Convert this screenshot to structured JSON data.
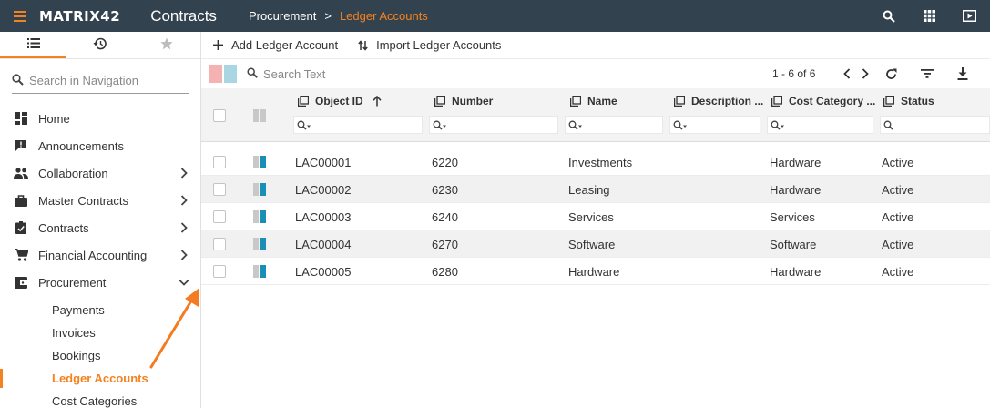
{
  "app": {
    "logo": "MATRIX42",
    "title": "Contracts",
    "breadcrumb": {
      "parent": "Procurement",
      "separator": ">",
      "current": "Ledger Accounts"
    },
    "top_icons": [
      "search-icon",
      "apps-grid-icon",
      "play-icon"
    ]
  },
  "sidebar": {
    "tabs": [
      {
        "icon": "list-icon",
        "active": true
      },
      {
        "icon": "history-icon",
        "active": false
      },
      {
        "icon": "star-icon",
        "active": false
      }
    ],
    "search": {
      "placeholder": "Search in Navigation",
      "value": ""
    },
    "items": [
      {
        "label": "Home",
        "icon": "dashboard-icon",
        "chevron": ""
      },
      {
        "label": "Announcements",
        "icon": "announcement-icon",
        "chevron": ""
      },
      {
        "label": "Collaboration",
        "icon": "people-icon",
        "chevron": "right"
      },
      {
        "label": "Master Contracts",
        "icon": "briefcase-icon",
        "chevron": "right"
      },
      {
        "label": "Contracts",
        "icon": "clipboard-check-icon",
        "chevron": "right"
      },
      {
        "label": "Financial Accounting",
        "icon": "cart-icon",
        "chevron": "right"
      },
      {
        "label": "Procurement",
        "icon": "wallet-icon",
        "chevron": "down"
      }
    ],
    "sub_items": [
      {
        "label": "Payments",
        "active": false
      },
      {
        "label": "Invoices",
        "active": false
      },
      {
        "label": "Bookings",
        "active": false
      },
      {
        "label": "Ledger Accounts",
        "active": true
      },
      {
        "label": "Cost Categories",
        "active": false
      }
    ]
  },
  "toolbar": {
    "add_label": "Add Ledger Account",
    "import_label": "Import Ledger Accounts"
  },
  "filterbar": {
    "search_placeholder": "Search Text",
    "pager_text": "1 - 6 of 6"
  },
  "table": {
    "columns": [
      {
        "label": "Object ID",
        "sort": "asc"
      },
      {
        "label": "Number"
      },
      {
        "label": "Name"
      },
      {
        "label": "Description ..."
      },
      {
        "label": "Cost Category ..."
      },
      {
        "label": "Status"
      }
    ],
    "rows": [
      {
        "object_id": "LAC00001",
        "number": "6220",
        "name": "Investments",
        "description": "",
        "cost_category": "Hardware",
        "status": "Active"
      },
      {
        "object_id": "LAC00002",
        "number": "6230",
        "name": "Leasing",
        "description": "",
        "cost_category": "Hardware",
        "status": "Active"
      },
      {
        "object_id": "LAC00003",
        "number": "6240",
        "name": "Services",
        "description": "",
        "cost_category": "Services",
        "status": "Active"
      },
      {
        "object_id": "LAC00004",
        "number": "6270",
        "name": "Software",
        "description": "",
        "cost_category": "Software",
        "status": "Active"
      },
      {
        "object_id": "LAC00005",
        "number": "6280",
        "name": "Hardware",
        "description": "",
        "cost_category": "Hardware",
        "status": "Active"
      }
    ]
  },
  "colors": {
    "topbar": "#33424f",
    "accent": "#f58220",
    "status_light": "#c8c8c8",
    "status_blue": "#1a8fb5"
  }
}
